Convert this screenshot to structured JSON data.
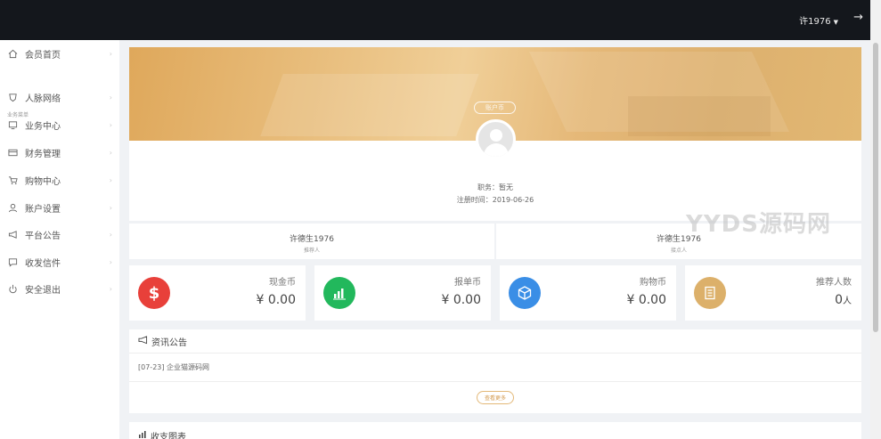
{
  "topbar": {
    "username": "许1976",
    "logout_icon": "arrow-right-icon"
  },
  "sidebar": {
    "section_label": "业务菜单",
    "items": [
      {
        "label": "会员首页",
        "icon": "home-icon"
      },
      {
        "label": "人脉网络",
        "icon": "network-icon"
      },
      {
        "label": "业务中心",
        "icon": "monitor-icon"
      },
      {
        "label": "财务管理",
        "icon": "card-icon"
      },
      {
        "label": "购物中心",
        "icon": "cart-icon"
      },
      {
        "label": "账户设置",
        "icon": "user-icon"
      },
      {
        "label": "平台公告",
        "icon": "megaphone-icon"
      },
      {
        "label": "收发信件",
        "icon": "message-icon"
      },
      {
        "label": "安全退出",
        "icon": "power-icon"
      }
    ]
  },
  "profile": {
    "tag": "账户币",
    "position_text": "职务：暂无",
    "register_text": "注册时间：2019-06-26"
  },
  "referrers": [
    {
      "name": "许德生1976",
      "role": "推荐人"
    },
    {
      "name": "许德生1976",
      "role": "接点人"
    }
  ],
  "watermark": "YYDS源码网",
  "stats": [
    {
      "label": "现金币",
      "value": "¥ 0.00",
      "color": "#e8403a",
      "icon": "dollar-icon"
    },
    {
      "label": "报单币",
      "value": "¥ 0.00",
      "color": "#22b85c",
      "icon": "bar-chart-icon"
    },
    {
      "label": "购物币",
      "value": "¥ 0.00",
      "color": "#3a8ee6",
      "icon": "box-icon"
    },
    {
      "label": "推荐人数",
      "value": "0",
      "unit": "人",
      "color": "#dcb06a",
      "icon": "document-icon"
    }
  ],
  "news": {
    "title": "资讯公告",
    "items": [
      {
        "text": "[07-23] 企业猫源码网"
      }
    ],
    "more_label": "查看更多"
  },
  "chart_panel": {
    "title": "收支图表"
  }
}
